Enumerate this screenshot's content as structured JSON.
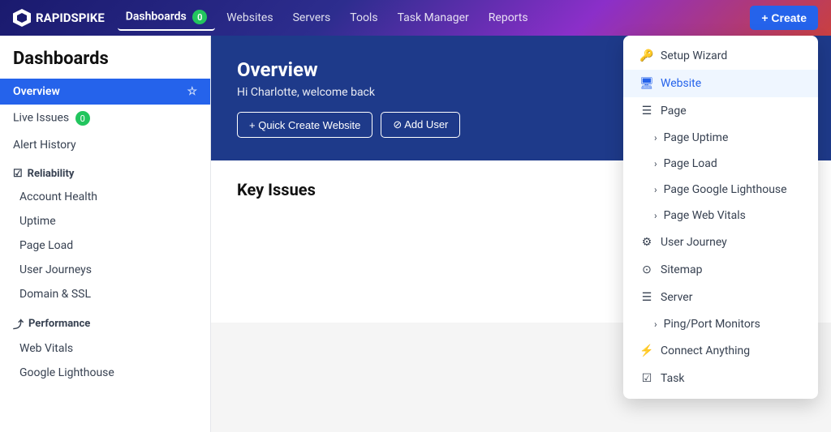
{
  "logo": {
    "text": "RAPIDSPIKE"
  },
  "nav": {
    "items": [
      {
        "label": "Dashboards",
        "active": true,
        "badge": "0"
      },
      {
        "label": "Websites",
        "active": false
      },
      {
        "label": "Servers",
        "active": false
      },
      {
        "label": "Tools",
        "active": false
      },
      {
        "label": "Task Manager",
        "active": false
      },
      {
        "label": "Reports",
        "active": false
      }
    ],
    "create_button": "+ Create"
  },
  "sidebar": {
    "title": "Dashboards",
    "items": [
      {
        "label": "Overview",
        "active": true,
        "type": "top"
      },
      {
        "label": "Live Issues",
        "active": false,
        "badge": "0",
        "type": "top"
      },
      {
        "label": "Alert History",
        "active": false,
        "type": "top"
      }
    ],
    "sections": [
      {
        "label": "Reliability",
        "icon": "☑",
        "items": [
          "Account Health",
          "Uptime",
          "Page Load",
          "User Journeys",
          "Domain & SSL"
        ]
      },
      {
        "label": "Performance",
        "icon": "⤴",
        "items": [
          "Web Vitals",
          "Google Lighthouse"
        ]
      }
    ]
  },
  "main": {
    "banner": {
      "title": "Overview",
      "subtitle": "Hi Charlotte, welcome back",
      "buttons": [
        {
          "label": "+ Quick Create Website"
        },
        {
          "label": "⊘ Add User"
        }
      ]
    },
    "key_issues_title": "Key Issues"
  },
  "dropdown": {
    "items": [
      {
        "label": "Setup Wizard",
        "icon": "🔑",
        "type": "normal"
      },
      {
        "label": "Website",
        "icon": "🖥",
        "type": "highlighted"
      },
      {
        "label": "Page",
        "icon": "☰",
        "type": "parent"
      },
      {
        "label": "Page Uptime",
        "type": "sub",
        "chevron": ">"
      },
      {
        "label": "Page Load",
        "type": "sub",
        "chevron": ">"
      },
      {
        "label": "Page Google Lighthouse",
        "type": "sub",
        "chevron": ">"
      },
      {
        "label": "Page Web Vitals",
        "type": "sub",
        "chevron": ">"
      },
      {
        "label": "User Journey",
        "icon": "⚙",
        "type": "normal"
      },
      {
        "label": "Sitemap",
        "icon": "⊙",
        "type": "normal"
      },
      {
        "label": "Server",
        "icon": "☰",
        "type": "parent"
      },
      {
        "label": "Ping/Port Monitors",
        "type": "sub",
        "chevron": ">"
      },
      {
        "label": "Connect Anything",
        "icon": "⚡",
        "type": "normal"
      },
      {
        "label": "Task",
        "icon": "☑",
        "type": "normal"
      }
    ]
  }
}
